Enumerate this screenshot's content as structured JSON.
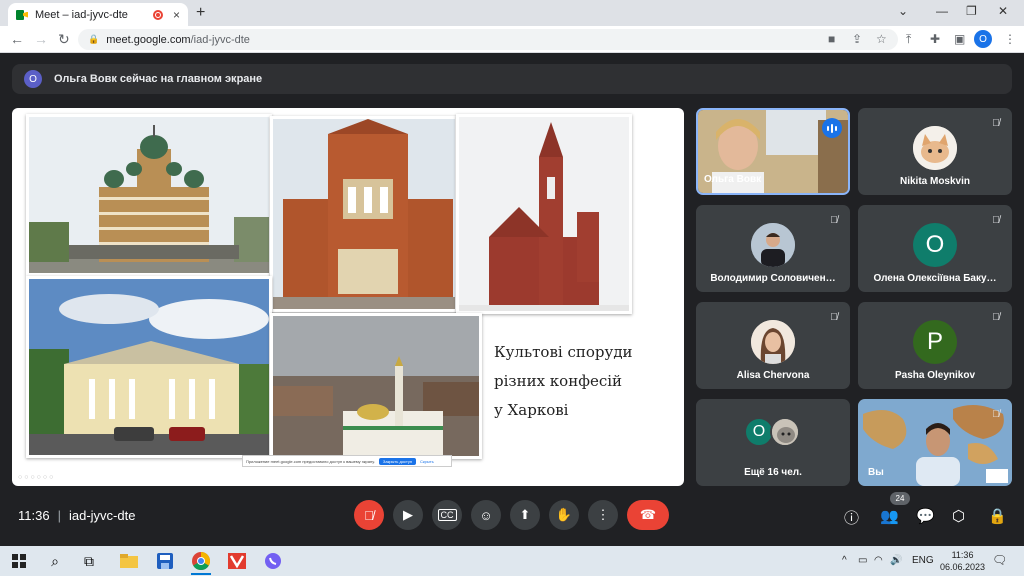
{
  "browser": {
    "tab_title": "Meet – iad-jyvc-dte",
    "tab_close": "×",
    "new_tab": "+",
    "url_host": "meet.google.com",
    "url_path": "/iad-jyvc-dte",
    "profile_initial": "O"
  },
  "banner": {
    "avatar_initial": "O",
    "text": "Ольга Вовк сейчас на главном экране"
  },
  "slide": {
    "title_lines": [
      "Культові споруди",
      "різних конфесій",
      "у Харкові"
    ],
    "share_bar": {
      "text": "Приложение meet.google.com предоставило доступ к вашему экрану.",
      "stop_button": "Закрыть доступ",
      "hide_link": "Скрыть"
    }
  },
  "participants": [
    {
      "name": "Ольга Вовк",
      "speaking": true
    },
    {
      "name": "Nikita Moskvin",
      "muted": true
    },
    {
      "name": "Володимир Соловичен…",
      "muted": true
    },
    {
      "name": "Олена Олексіївна Баку…",
      "muted": true,
      "initial": "O",
      "color": "#0f7d6b"
    },
    {
      "name": "Alisa Chervona",
      "muted": true
    },
    {
      "name": "Pasha Oleynikov",
      "muted": true,
      "initial": "P",
      "color": "#33691e"
    },
    {
      "name": "Ещё 16 чел.",
      "initial": "O",
      "color": "#0f7d6b"
    },
    {
      "name": "Вы",
      "muted": true
    }
  ],
  "controls": {
    "time": "11:36",
    "meeting_code": "iad-jyvc-dte",
    "people_count": "24"
  },
  "taskbar": {
    "lang": "ENG",
    "time": "11:36",
    "date": "06.06.2023"
  },
  "colors": {
    "meet_bg": "#202124",
    "tile_bg": "#3c4043",
    "hangup_red": "#ea4335",
    "accent_blue": "#1a73e8"
  }
}
